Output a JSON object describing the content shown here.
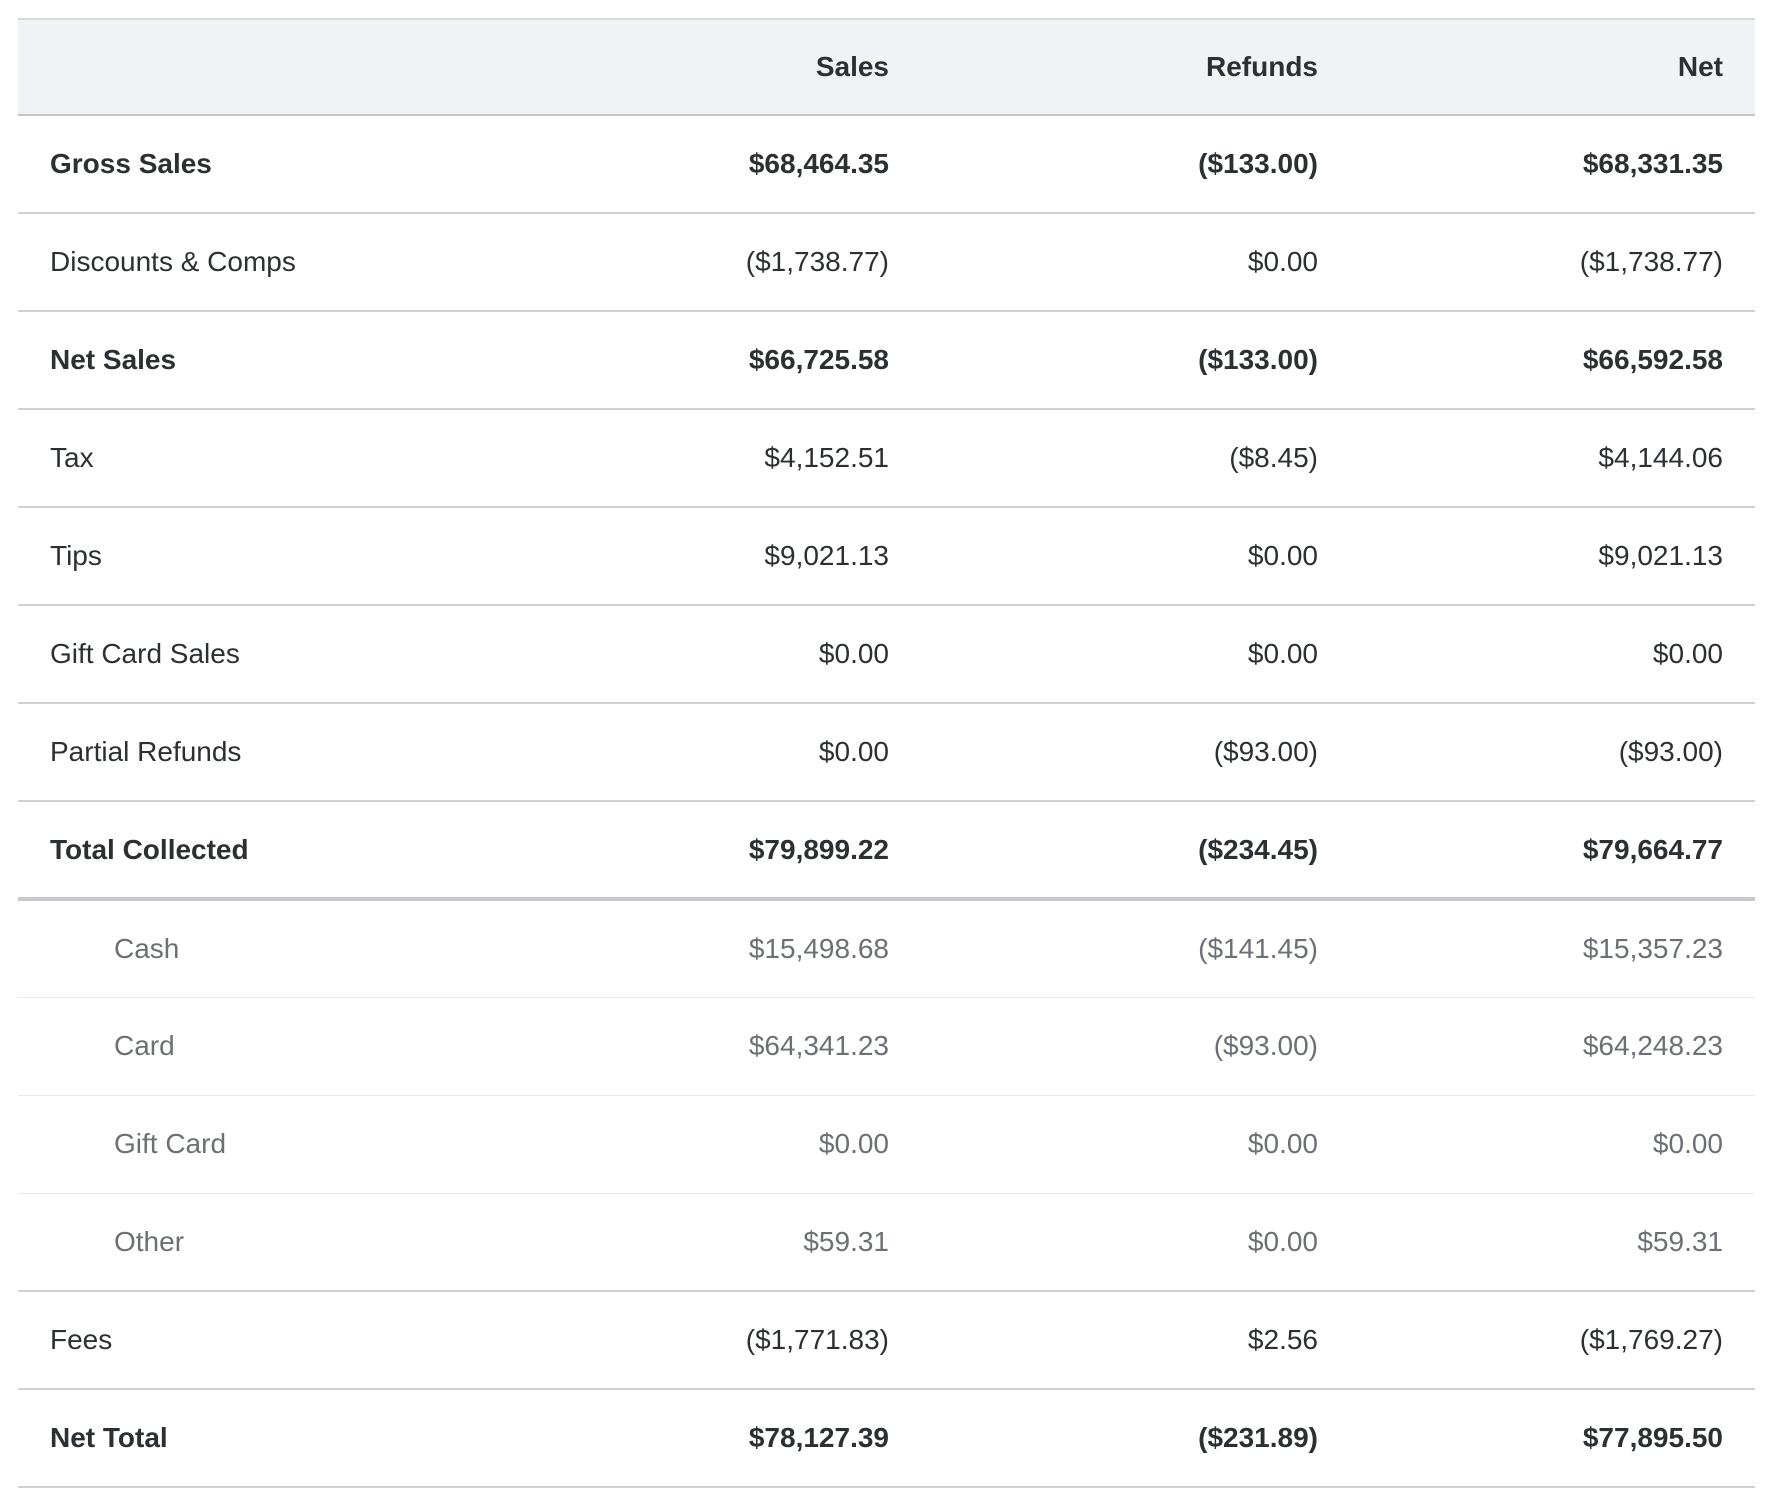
{
  "table": {
    "headers": [
      "",
      "Sales",
      "Refunds",
      "Net"
    ],
    "rows": [
      {
        "label": "Gross Sales",
        "sales": "$68,464.35",
        "refunds": "($133.00)",
        "net": "$68,331.35",
        "style": "bold"
      },
      {
        "label": "Discounts & Comps",
        "sales": "($1,738.77)",
        "refunds": "$0.00",
        "net": "($1,738.77)",
        "style": "normal"
      },
      {
        "label": "Net Sales",
        "sales": "$66,725.58",
        "refunds": "($133.00)",
        "net": "$66,592.58",
        "style": "bold"
      },
      {
        "label": "Tax",
        "sales": "$4,152.51",
        "refunds": "($8.45)",
        "net": "$4,144.06",
        "style": "normal"
      },
      {
        "label": "Tips",
        "sales": "$9,021.13",
        "refunds": "$0.00",
        "net": "$9,021.13",
        "style": "normal"
      },
      {
        "label": "Gift Card Sales",
        "sales": "$0.00",
        "refunds": "$0.00",
        "net": "$0.00",
        "style": "normal"
      },
      {
        "label": "Partial Refunds",
        "sales": "$0.00",
        "refunds": "($93.00)",
        "net": "($93.00)",
        "style": "normal"
      },
      {
        "label": "Total Collected",
        "sales": "$79,899.22",
        "refunds": "($234.45)",
        "net": "$79,664.77",
        "style": "bold"
      },
      {
        "label": "Cash",
        "sales": "$15,498.68",
        "refunds": "($141.45)",
        "net": "$15,357.23",
        "style": "sub"
      },
      {
        "label": "Card",
        "sales": "$64,341.23",
        "refunds": "($93.00)",
        "net": "$64,248.23",
        "style": "sub"
      },
      {
        "label": "Gift Card",
        "sales": "$0.00",
        "refunds": "$0.00",
        "net": "$0.00",
        "style": "sub"
      },
      {
        "label": "Other",
        "sales": "$59.31",
        "refunds": "$0.00",
        "net": "$59.31",
        "style": "sub"
      },
      {
        "label": "Fees",
        "sales": "($1,771.83)",
        "refunds": "$2.56",
        "net": "($1,769.27)",
        "style": "normal"
      },
      {
        "label": "Net Total",
        "sales": "$78,127.39",
        "refunds": "($231.89)",
        "net": "$77,895.50",
        "style": "bold"
      }
    ]
  },
  "colors": {
    "header_bg": "#f1f2f4",
    "text_primary": "#2c3033",
    "text_secondary": "#6c7075",
    "divider": "#cfd2d5"
  }
}
